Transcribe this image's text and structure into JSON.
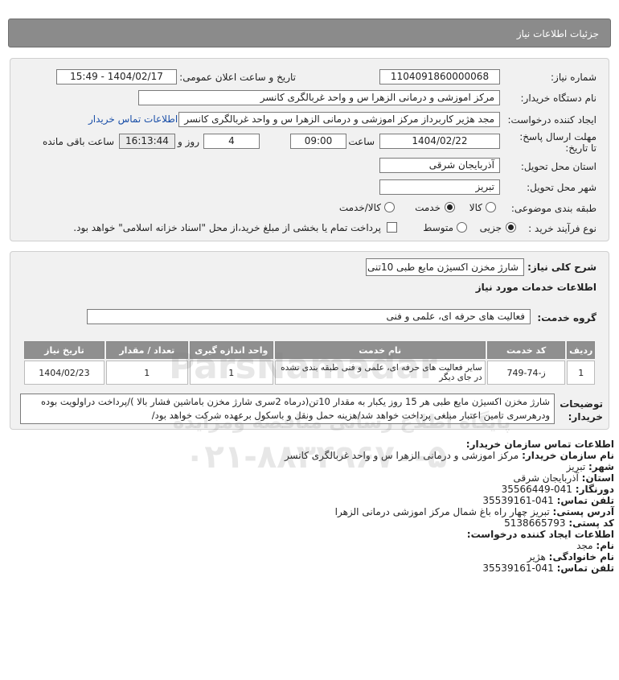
{
  "header": {
    "title": "جزئیات اطلاعات نیاز"
  },
  "form": {
    "need_number_label": "شماره نیاز:",
    "need_number": "1104091860000068",
    "announce_label": "تاریخ و ساعت اعلان عمومی:",
    "announce_value": "1404/02/17 - 15:49",
    "buyer_org_label": "نام دستگاه خریدار:",
    "buyer_org": "مرکز اموزشی و درمانی الزهرا س  و واحد غربالگری کانسر",
    "creator_label": "ایجاد کننده درخواست:",
    "creator": "مجد هژیر کاربرداز مرکز اموزشی و درمانی الزهرا س  و واحد غربالگری کانسر",
    "buyer_contact_link": "اطلاعات تماس خریدار",
    "deadline_label": "مهلت ارسال پاسخ: تا تاریخ:",
    "deadline_date": "1404/02/22",
    "time_label": "ساعت",
    "deadline_time": "09:00",
    "days_value": "4",
    "days_label": "روز و",
    "remaining_time": "16:13:44",
    "remaining_label": "ساعت باقی مانده",
    "province_label": "استان محل تحویل:",
    "province": "آذربایجان شرقی",
    "city_label": "شهر محل تحویل:",
    "city": "تبریز",
    "category_label": "طبقه بندی موضوعی:",
    "category_options": [
      "کالا",
      "خدمت",
      "کالا/خدمت"
    ],
    "category_selected": "خدمت",
    "process_label": "نوع فرآیند خرید :",
    "process_options": [
      "جزیی",
      "متوسط"
    ],
    "process_selected": "جزیی",
    "payment_note": "پرداخت تمام یا بخشی از مبلغ خرید،از محل \"اسناد خزانه اسلامی\" خواهد بود."
  },
  "section2": {
    "summary_label": "شرح کلی نیاز:",
    "summary": "شارژ مخزن اکسیژن مایع طبی 10تنی",
    "services_title": "اطلاعات خدمات مورد نیاز",
    "group_label": "گروه خدمت:",
    "group_value": "فعالیت های حرفه ای، علمی و فنی",
    "table": {
      "headers": [
        "ردیف",
        "کد خدمت",
        "نام خدمت",
        "واحد اندازه گیری",
        "تعداد / مقدار",
        "تاریخ نیاز"
      ],
      "rows": [
        [
          "1",
          "ز-74-749",
          "سایر فعالیت های حرفه ای، علمی و فنی طبقه بندی نشده در جای دیگر",
          "1",
          "1",
          "1404/02/23"
        ]
      ]
    },
    "buyer_notes_label": "توضیحات خریدار:",
    "buyer_notes": "شارژ مخزن اکسیژن مایع طبی هر 15 روز یکبار به مقدار 10تن(درماه 2سری شارژ مخزن باماشین فشار بالا )/پرداخت دراولویت بوده ودرهرسری تامین اعتبار مبلغی پرداخت خواهد شد/هزینه حمل ونقل و باسکول برعهده شرکت خواهد بود/"
  },
  "contact": {
    "title": "اطلاعات تماس سازمان خریدار:",
    "org_label": "نام سازمان خریدار:",
    "org": "مرکز اموزشی و درمانی الزهرا س و واحد غربالگری کانسر",
    "city_label": "شهر:",
    "city": "تبریز",
    "province_label": "استان:",
    "province": "آذربایجان شرقی",
    "fax_label": "دورنگار:",
    "fax": "041-35566449",
    "phone_label": "تلفن تماس:",
    "phone": "041-35539161",
    "address_label": "آدرس پستی:",
    "address": "تبریز چهار راه باغ شمال مرکز اموزشی درمانی الزهرا",
    "postal_label": "کد پستی:",
    "postal": "5138665793",
    "creator_title": "اطلاعات ایجاد کننده درخواست:",
    "first_name_label": "نام:",
    "first_name": "مجد",
    "last_name_label": "نام خانوادگی:",
    "last_name": "هژیر",
    "creator_phone_label": "تلفن تماس:",
    "creator_phone": "041-35539161"
  },
  "watermark": {
    "line1": "ParsNamadar",
    "line2": "پایگاه اطلاع رسانی مناقصه ومزایده",
    "phone": "۰۲۱-۸۸۳۴۹۶۷۰-۵"
  }
}
